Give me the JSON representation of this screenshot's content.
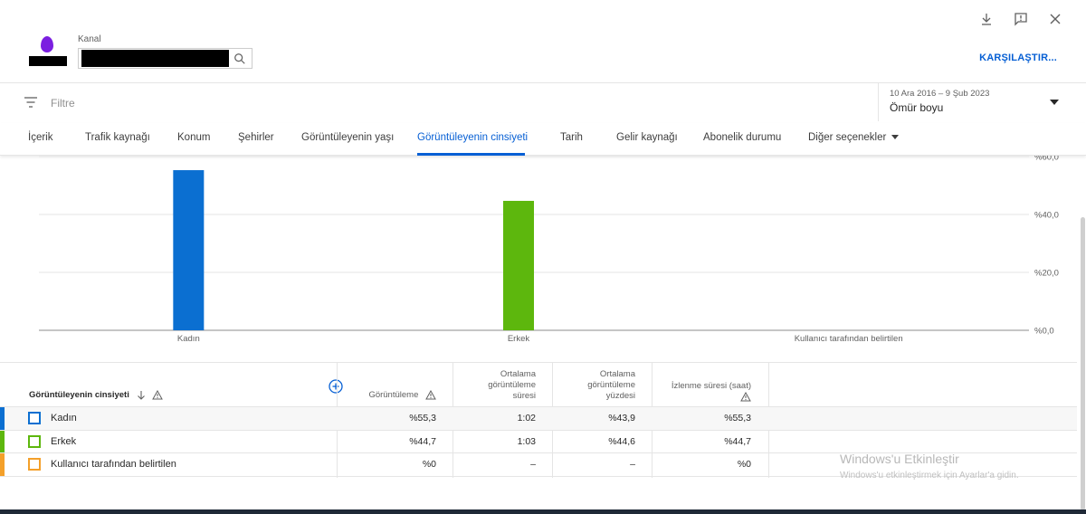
{
  "header": {
    "channel_label": "Kanal",
    "compare_label": "KARŞILAŞTIR..."
  },
  "filter": {
    "placeholder": "Filtre",
    "date_range": "10 Ara 2016 – 9 Şub 2023",
    "period": "Ömür boyu"
  },
  "tabs": [
    {
      "label": "İçerik"
    },
    {
      "label": "Trafik kaynağı"
    },
    {
      "label": "Konum"
    },
    {
      "label": "Şehirler"
    },
    {
      "label": "Görüntüleyenin yaşı"
    },
    {
      "label": "Görüntüleyenin cinsiyeti"
    },
    {
      "label": "Tarih"
    },
    {
      "label": "Gelir kaynağı"
    },
    {
      "label": "Abonelik durumu"
    },
    {
      "label": "Diğer seçenekler"
    }
  ],
  "active_tab_index": 5,
  "chart_data": {
    "type": "bar",
    "categories": [
      "Kadın",
      "Erkek",
      "Kullanıcı tarafından belirtilen"
    ],
    "values": [
      55.3,
      44.7,
      0
    ],
    "colors": [
      "#0b6fd1",
      "#5db70d",
      "#f4a02a"
    ],
    "y_ticks": [
      "%0,0",
      "%20,0",
      "%40,0",
      "%60,0"
    ],
    "y_tick_values": [
      0,
      20,
      40,
      60
    ],
    "ylim": [
      0,
      60
    ],
    "grid": true
  },
  "table": {
    "columns": [
      {
        "label": "Görüntüleyenin cinsiyeti"
      },
      {
        "label": "Görüntüleme"
      },
      {
        "label": "Ortalama görüntüleme süresi"
      },
      {
        "label": "Ortalama görüntüleme yüzdesi"
      },
      {
        "label": "İzlenme süresi (saat)"
      }
    ],
    "rows": [
      {
        "name": "Kadın",
        "views": "%55,3",
        "avg_duration": "1:02",
        "avg_percent": "%43,9",
        "watch_time": "%55,3",
        "color": "#0b6fd1"
      },
      {
        "name": "Erkek",
        "views": "%44,7",
        "avg_duration": "1:03",
        "avg_percent": "%44,6",
        "watch_time": "%44,7",
        "color": "#5db70d"
      },
      {
        "name": "Kullanıcı tarafından belirtilen",
        "views": "%0",
        "avg_duration": "–",
        "avg_percent": "–",
        "watch_time": "%0",
        "color": "#f4a02a"
      }
    ]
  },
  "watermark": {
    "title": "Windows'u Etkinleştir",
    "subtitle": "Windows'u etkinleştirmek için Ayarlar'a gidin."
  },
  "icons": [
    "download-icon",
    "feedback-icon",
    "close-icon",
    "search-icon",
    "filter-icon",
    "add-column-icon",
    "sort-down-icon",
    "warning-icon"
  ]
}
